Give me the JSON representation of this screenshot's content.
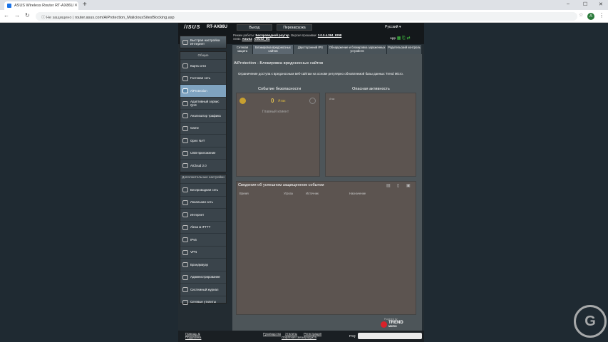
{
  "browser": {
    "tab_title": "ASUS Wireless Router RT-AX86U",
    "security": "Не защищено",
    "url": "router.asus.com/AiProtection_MaliciousSitesBlocking.asp",
    "avatar": "A"
  },
  "header": {
    "logo": "/ISUS",
    "model": "RT-AX86U",
    "logout": "Выход",
    "reboot": "Перезагрузка",
    "language": "Русский",
    "mode_label": "Режим работы:",
    "mode_value": "Беспроводной роутер",
    "fw_label": "Версия прошивки:",
    "fw_value": "3.0.0.4.384_9298",
    "ssid_label": "SSID:",
    "ssid_1": "ASUS2",
    "ssid_2": "ASUS2_5G",
    "app_label": "App"
  },
  "sidebar": {
    "quick_setup": "Быстрая настройка Интернет",
    "general_header": "Общие",
    "general_items": [
      {
        "label": "Карта сети",
        "icon": "network-map-icon"
      },
      {
        "label": "Гостевая сеть",
        "icon": "guest-network-icon"
      },
      {
        "label": "AiProtection",
        "icon": "shield-icon",
        "active": true
      },
      {
        "label": "Адаптивный сервис QoS",
        "icon": "qos-icon"
      },
      {
        "label": "Анализатор трафика",
        "icon": "traffic-analyzer-icon"
      },
      {
        "label": "Game",
        "icon": "gamepad-icon"
      },
      {
        "label": "Open NAT",
        "icon": "open-nat-icon"
      },
      {
        "label": "USB-приложение",
        "icon": "usb-icon"
      },
      {
        "label": "AiCloud 2.0",
        "icon": "cloud-icon"
      }
    ],
    "advanced_header": "Дополнительные настройки",
    "advanced_items": [
      {
        "label": "Беспроводная сеть",
        "icon": "wireless-icon"
      },
      {
        "label": "Локальная сеть",
        "icon": "lan-icon"
      },
      {
        "label": "Интернет",
        "icon": "globe-icon"
      },
      {
        "label": "Alexa & IFTTT",
        "icon": "alexa-icon"
      },
      {
        "label": "IPv6",
        "icon": "ipv6-icon"
      },
      {
        "label": "VPN",
        "icon": "vpn-icon"
      },
      {
        "label": "Брандмауэр",
        "icon": "firewall-icon"
      },
      {
        "label": "Администрирование",
        "icon": "admin-icon"
      },
      {
        "label": "Системный журнал",
        "icon": "log-icon"
      },
      {
        "label": "Сетевые утилиты",
        "icon": "tools-icon"
      }
    ]
  },
  "tabs": [
    {
      "label": "Сетевая защита"
    },
    {
      "label": "Блокировка вредоносных сайтов",
      "active": true
    },
    {
      "label": "Двусторонний IPS"
    },
    {
      "label": "Обнаружение и блокировка зараженных устройств"
    },
    {
      "label": "Родительский контроль"
    }
  ],
  "main": {
    "title": "AiProtection - Блокировка вредоносных сайтов",
    "description": "Ограничение доступа к вредоносным веб-сайтам на основе регулярно обновляемой базы данных Trend Micro.",
    "security_event_title": "Событие безопасности",
    "hits_value": "0",
    "hits_unit": "Атак",
    "host_label": "Главный клиент",
    "dangerous_title": "Опасная активность",
    "dangerous_small": "Атак",
    "events_title": "Сведения об успешном защищенном событии",
    "col_time": "Время",
    "col_threat": "Угроза",
    "col_source": "Источник",
    "col_dest": "Назначение",
    "powered_by": "Powered by",
    "trend_name": "TREND",
    "trend_sub": "MICRO"
  },
  "footer": {
    "help": "Помощь & Поддержка",
    "manual": "Руководство",
    "utility": "Утилиты",
    "registration": "Регистрация продукта",
    "feedback": "Обратная связь",
    "faq": "FAQ"
  },
  "watermark": "G"
}
